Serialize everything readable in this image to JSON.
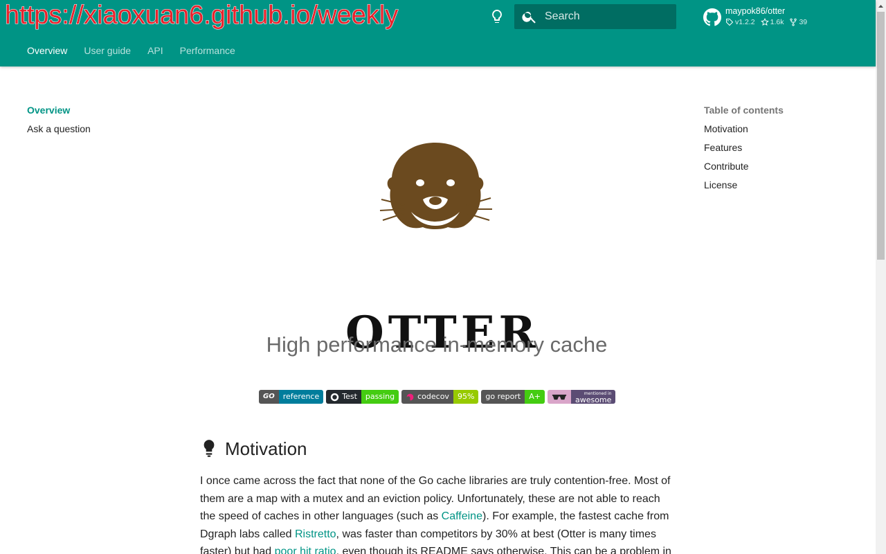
{
  "header": {
    "site_url": "https://xiaoxuan6.github.io/weekly",
    "search_placeholder": "Search",
    "repo": {
      "name": "maypok86/otter",
      "version": "v1.2.2",
      "stars": "1.6k",
      "forks": "39"
    },
    "tabs": [
      {
        "label": "Overview",
        "active": true
      },
      {
        "label": "User guide",
        "active": false
      },
      {
        "label": "API",
        "active": false
      },
      {
        "label": "Performance",
        "active": false
      }
    ],
    "colors": {
      "primary": "#009485",
      "url_text": "#e8232d"
    }
  },
  "left_nav": [
    {
      "label": "Overview",
      "active": true
    },
    {
      "label": "Ask a question",
      "active": false
    }
  ],
  "toc": {
    "title": "Table of contents",
    "items": [
      "Motivation",
      "Features",
      "Contribute",
      "License"
    ]
  },
  "content": {
    "logo_text": "OTTER",
    "tagline": "High performance in-memory cache",
    "badges": [
      {
        "left": "GO",
        "right": "reference",
        "right_color": "#007d9c",
        "icon": "go-icon"
      },
      {
        "left": "Test",
        "right": "passing",
        "right_color": "#4c1",
        "icon": "github-icon"
      },
      {
        "left": "codecov",
        "right": "95%",
        "right_color": "#97ca00",
        "icon": "codecov-icon"
      },
      {
        "left": "go report",
        "right": "A+",
        "right_color": "#4c1",
        "icon": ""
      },
      {
        "left": "mentioned in",
        "right": "awesome",
        "right_color": "#5b4c74",
        "icon": "sunglasses-icon"
      }
    ],
    "motivation_heading": "Motivation",
    "paragraph": {
      "t1": "I once came across the fact that none of the Go cache libraries are truly contention-free. Most of them are a map with a mutex and an eviction policy. Unfortunately, these are not able to reach the speed of caches in other languages (such as ",
      "link1": "Caffeine",
      "t2": "). For example, the fastest cache from Dgraph labs called ",
      "link2": "Ristretto",
      "t3": ", was faster than competitors by 30% at best (Otter is many times faster) but had ",
      "link3": "poor hit ratio",
      "t4": ", even though its README says otherwise. This can be a problem in"
    }
  }
}
